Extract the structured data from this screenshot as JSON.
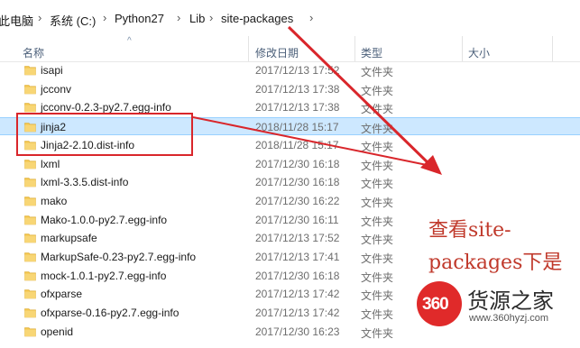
{
  "breadcrumb": {
    "items": [
      "此电脑",
      "系统 (C:)",
      "Python27",
      "Lib",
      "site-packages"
    ]
  },
  "columns": {
    "name": "名称",
    "date": "修改日期",
    "type": "类型",
    "size": "大小"
  },
  "files": [
    {
      "name": "isapi",
      "date": "2017/12/13 17:52",
      "type": "文件夹"
    },
    {
      "name": "jcconv",
      "date": "2017/12/13 17:38",
      "type": "文件夹"
    },
    {
      "name": "jcconv-0.2.3-py2.7.egg-info",
      "date": "2017/12/13 17:38",
      "type": "文件夹"
    },
    {
      "name": "jinja2",
      "date": "2018/11/28 15:17",
      "type": "文件夹",
      "selected": true
    },
    {
      "name": "Jinja2-2.10.dist-info",
      "date": "2018/11/28 15:17",
      "type": "文件夹"
    },
    {
      "name": "lxml",
      "date": "2017/12/30 16:18",
      "type": "文件夹"
    },
    {
      "name": "lxml-3.3.5.dist-info",
      "date": "2017/12/30 16:18",
      "type": "文件夹"
    },
    {
      "name": "mako",
      "date": "2017/12/30 16:22",
      "type": "文件夹"
    },
    {
      "name": "Mako-1.0.0-py2.7.egg-info",
      "date": "2017/12/30 16:11",
      "type": "文件夹"
    },
    {
      "name": "markupsafe",
      "date": "2017/12/13 17:52",
      "type": "文件夹"
    },
    {
      "name": "MarkupSafe-0.23-py2.7.egg-info",
      "date": "2017/12/13 17:41",
      "type": "文件夹"
    },
    {
      "name": "mock-1.0.1-py2.7.egg-info",
      "date": "2017/12/30 16:18",
      "type": "文件夹"
    },
    {
      "name": "ofxparse",
      "date": "2017/12/13 17:42",
      "type": "文件夹"
    },
    {
      "name": "ofxparse-0.16-py2.7.egg-info",
      "date": "2017/12/13 17:42",
      "type": "文件夹"
    },
    {
      "name": "openid",
      "date": "2017/12/30 16:23",
      "type": "文件夹"
    }
  ],
  "annotation": {
    "line1": "查看site-",
    "line2": "packages下是"
  },
  "watermark": {
    "number": "360",
    "brand": "货源之家",
    "url": "www.360hyzj.com"
  },
  "colors": {
    "folder": "#f3c64e",
    "selection": "#cde8ff",
    "annotation": "#d9262b"
  }
}
